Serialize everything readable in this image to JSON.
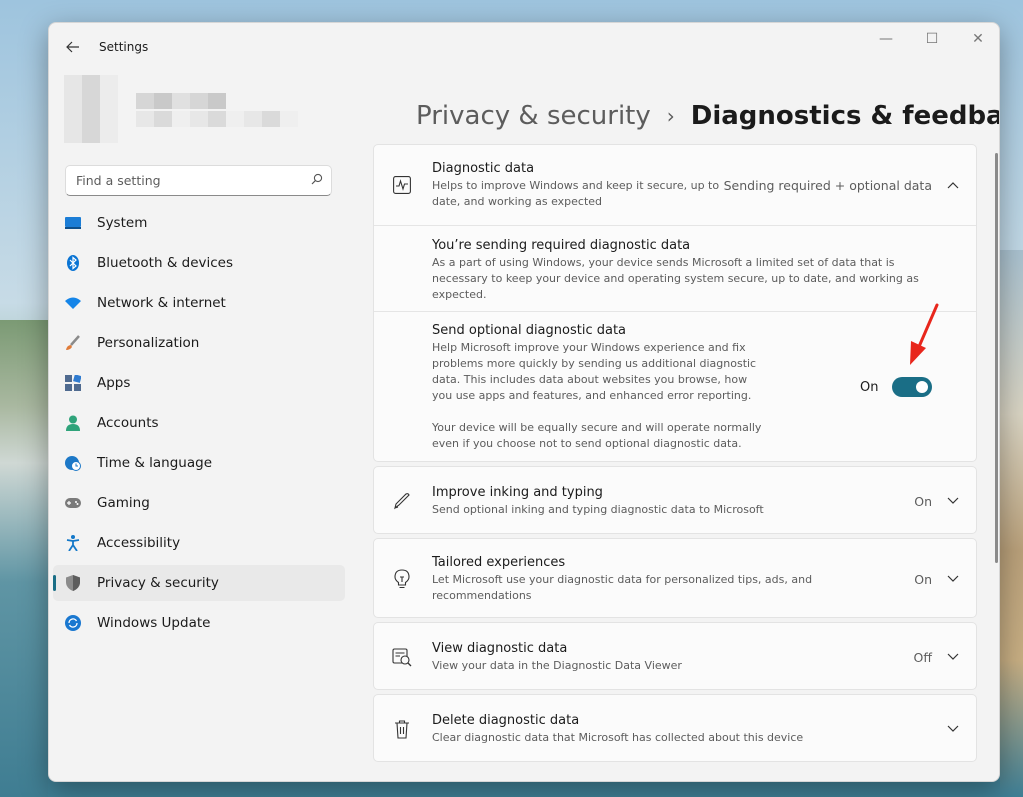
{
  "window": {
    "app_title": "Settings",
    "back_icon": "arrow-left-icon",
    "controls": {
      "minimize": "—",
      "maximize": "☐",
      "close": "✕"
    }
  },
  "search": {
    "placeholder": "Find a setting"
  },
  "sidebar": {
    "items": [
      {
        "label": "System",
        "icon": "monitor-icon",
        "color": "#1b7dd6"
      },
      {
        "label": "Bluetooth & devices",
        "icon": "bluetooth-icon",
        "color": "#0a74d4"
      },
      {
        "label": "Network & internet",
        "icon": "wifi-icon",
        "color": "#1585e8"
      },
      {
        "label": "Personalization",
        "icon": "brush-icon",
        "color": "#e07b39"
      },
      {
        "label": "Apps",
        "icon": "apps-icon",
        "color": "#4f6a8f"
      },
      {
        "label": "Accounts",
        "icon": "person-icon",
        "color": "#2fa37a"
      },
      {
        "label": "Time & language",
        "icon": "globe-clock-icon",
        "color": "#1d78c7"
      },
      {
        "label": "Gaming",
        "icon": "gamepad-icon",
        "color": "#7a7a7a"
      },
      {
        "label": "Accessibility",
        "icon": "accessibility-icon",
        "color": "#1378c9"
      },
      {
        "label": "Privacy & security",
        "icon": "shield-icon",
        "color": "#6b6b6b",
        "selected": true
      },
      {
        "label": "Windows Update",
        "icon": "sync-icon",
        "color": "#1a78d0"
      }
    ]
  },
  "breadcrumb": {
    "parent": "Privacy & security",
    "separator": "›",
    "current": "Diagnostics & feedback"
  },
  "diagnostic_data": {
    "title": "Diagnostic data",
    "desc": "Helps to improve Windows and keep it secure, up to date, and working as expected",
    "status": "Sending required + optional data",
    "expanded": true,
    "required": {
      "title": "You’re sending required diagnostic data",
      "desc": "As a part of using Windows, your device sends Microsoft a limited set of data that is necessary to keep your device and operating system secure, up to date, and working as expected."
    },
    "optional": {
      "title": "Send optional diagnostic data",
      "desc": "Help Microsoft improve your Windows experience and fix problems more quickly by sending us additional diagnostic data. This includes data about websites you browse, how you use apps and features, and enhanced error reporting.",
      "note": "Your device will be equally secure and will operate normally even if you choose not to send optional diagnostic data.",
      "toggle_label": "On",
      "toggle_on": true
    }
  },
  "settings_rows": [
    {
      "title": "Improve inking and typing",
      "desc": "Send optional inking and typing diagnostic data to Microsoft",
      "status": "On",
      "icon": "pen-icon"
    },
    {
      "title": "Tailored experiences",
      "desc": "Let Microsoft use your diagnostic data for personalized tips, ads, and recommendations",
      "status": "On",
      "icon": "lightbulb-icon"
    },
    {
      "title": "View diagnostic data",
      "desc": "View your data in the Diagnostic Data Viewer",
      "status": "Off",
      "icon": "data-viewer-icon"
    },
    {
      "title": "Delete diagnostic data",
      "desc": "Clear diagnostic data that Microsoft has collected about this device",
      "status": "",
      "icon": "trash-icon"
    }
  ],
  "colors": {
    "accent": "#1a6e86",
    "annotation_arrow": "#e8261c"
  }
}
